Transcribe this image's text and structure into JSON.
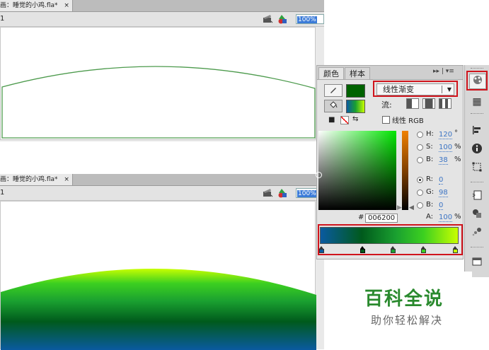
{
  "doc1": {
    "tab_title": "画：睡觉的小鸡.fla*",
    "close_glyph": "×",
    "scene": "1",
    "zoom": "100%"
  },
  "doc2": {
    "tab_title": "画：睡觉的小鸡.fla*",
    "close_glyph": "×",
    "scene": "1",
    "zoom": "100%"
  },
  "colors": {
    "gradient_stops": [
      "#0a5aa0",
      "#005a1c",
      "#1aa030",
      "#3cd020",
      "#c8ff00"
    ],
    "highlight_box": "#d0141c",
    "stroke_color": "#006200",
    "watermark_green": "#2a8a2e"
  },
  "panel": {
    "tab_color": "颜色",
    "tab_swatches": "样本",
    "menu_glyphs": "▸▸ | ▾≡",
    "fill_type": "线性渐变",
    "flow_label": "流:",
    "linear_rgb_label": "线性 RGB",
    "hsb": [
      {
        "label": "H:",
        "value": "120",
        "unit": "°"
      },
      {
        "label": "S:",
        "value": "100",
        "unit": "%"
      },
      {
        "label": "B:",
        "value": "38",
        "unit": "%"
      }
    ],
    "rgb": [
      {
        "label": "R:",
        "value": "0"
      },
      {
        "label": "G:",
        "value": "98"
      },
      {
        "label": "B:",
        "value": "0"
      }
    ],
    "alpha_label": "A:",
    "alpha_value": "100",
    "alpha_unit": "%",
    "hex_prefix": "#",
    "hex_value": "006200",
    "selected_mode": "R"
  },
  "dock_icons": [
    "color-panel-icon",
    "swatches-icon",
    "align-icon",
    "info-icon",
    "transform-icon",
    "code-icon",
    "components-icon",
    "motion-icon",
    "library-icon"
  ],
  "watermark": {
    "title": "百科全说",
    "subtitle": "助你轻松解决"
  }
}
